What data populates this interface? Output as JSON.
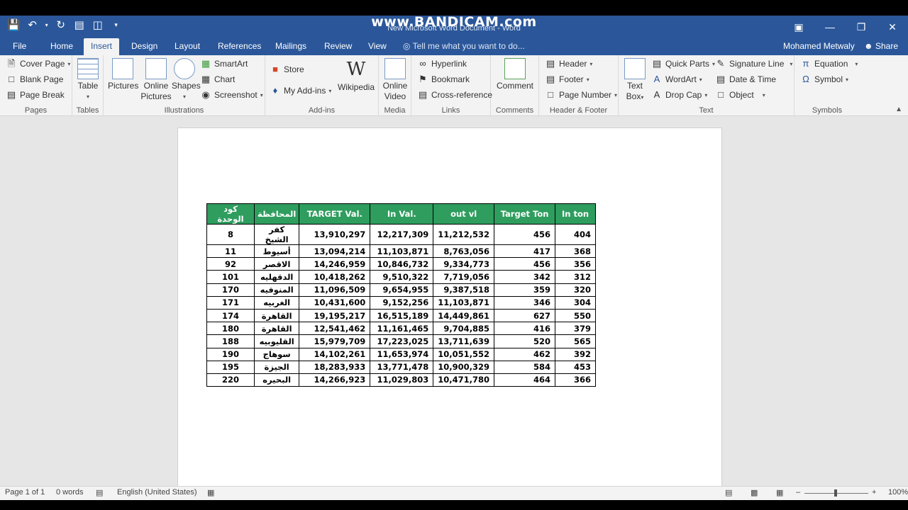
{
  "watermark": "www.BANDICAM.com",
  "window": {
    "title": "New Microsoft Word Document - Word"
  },
  "tabs": [
    {
      "label": "File"
    },
    {
      "label": "Home"
    },
    {
      "label": "Insert"
    },
    {
      "label": "Design"
    },
    {
      "label": "Layout"
    },
    {
      "label": "References"
    },
    {
      "label": "Mailings"
    },
    {
      "label": "Review"
    },
    {
      "label": "View"
    }
  ],
  "tell_me": "Tell me what you want to do...",
  "user": "Mohamed Metwaly",
  "share": "Share",
  "ribbon": {
    "pages": {
      "label": "Pages",
      "items": [
        "Cover Page",
        "Blank Page",
        "Page Break"
      ]
    },
    "tables": {
      "label": "Tables",
      "table": "Table"
    },
    "illustrations": {
      "label": "Illustrations",
      "pictures": "Pictures",
      "online_pictures_1": "Online",
      "online_pictures_2": "Pictures",
      "shapes": "Shapes",
      "smartart": "SmartArt",
      "chart": "Chart",
      "screenshot": "Screenshot"
    },
    "addins": {
      "label": "Add-ins",
      "store": "Store",
      "my_addins": "My Add-ins",
      "wikipedia": "Wikipedia"
    },
    "media": {
      "label": "Media",
      "online_video_1": "Online",
      "online_video_2": "Video"
    },
    "links": {
      "label": "Links",
      "hyperlink": "Hyperlink",
      "bookmark": "Bookmark",
      "crossref": "Cross-reference"
    },
    "comments": {
      "label": "Comments",
      "comment": "Comment"
    },
    "header_footer": {
      "label": "Header & Footer",
      "header": "Header",
      "footer": "Footer",
      "page_number": "Page Number"
    },
    "text": {
      "label": "Text",
      "textbox_1": "Text",
      "textbox_2": "Box",
      "quick_parts": "Quick Parts",
      "wordart": "WordArt",
      "drop_cap": "Drop Cap",
      "signature_line": "Signature Line",
      "date_time": "Date & Time",
      "object": "Object"
    },
    "symbols": {
      "label": "Symbols",
      "equation": "Equation",
      "symbol": "Symbol"
    }
  },
  "table": {
    "headers": [
      "كود الوحدة",
      "المحافظة",
      "TARGET  Val.",
      "In Val.",
      "out vl",
      "Target Ton",
      "In ton"
    ],
    "rows": [
      [
        "8",
        "كفر الشيخ",
        "13,910,297",
        "12,217,309",
        "11,212,532",
        "456",
        "404"
      ],
      [
        "11",
        "أسيوط",
        "13,094,214",
        "11,103,871",
        "8,763,056",
        "417",
        "368"
      ],
      [
        "92",
        "الاقصر",
        "14,246,959",
        "10,846,732",
        "9,334,773",
        "456",
        "356"
      ],
      [
        "101",
        "الدقهليه",
        "10,418,262",
        "9,510,322",
        "7,719,056",
        "342",
        "312"
      ],
      [
        "170",
        "المنوفيه",
        "11,096,509",
        "9,654,955",
        "9,387,518",
        "359",
        "320"
      ],
      [
        "171",
        "الغربيه",
        "10,431,600",
        "9,152,256",
        "11,103,871",
        "346",
        "304"
      ],
      [
        "174",
        "القاهرة",
        "19,195,217",
        "16,515,189",
        "14,449,861",
        "627",
        "550"
      ],
      [
        "180",
        "القاهرة",
        "12,541,462",
        "11,161,465",
        "9,704,885",
        "416",
        "379"
      ],
      [
        "188",
        "القليوبيه",
        "15,979,709",
        "17,223,025",
        "13,711,639",
        "520",
        "565"
      ],
      [
        "190",
        "سوهاج",
        "14,102,261",
        "11,653,974",
        "10,051,552",
        "462",
        "392"
      ],
      [
        "195",
        "الجيزة",
        "18,283,933",
        "13,771,478",
        "10,900,329",
        "584",
        "453"
      ],
      [
        "220",
        "البحيره",
        "14,266,923",
        "11,029,803",
        "10,471,780",
        "464",
        "366"
      ]
    ]
  },
  "status": {
    "page": "Page 1 of 1",
    "words": "0 words",
    "language": "English (United States)",
    "zoom": "100%"
  },
  "colors": {
    "accent": "#2b579a",
    "table_header": "#2e9d5e"
  }
}
